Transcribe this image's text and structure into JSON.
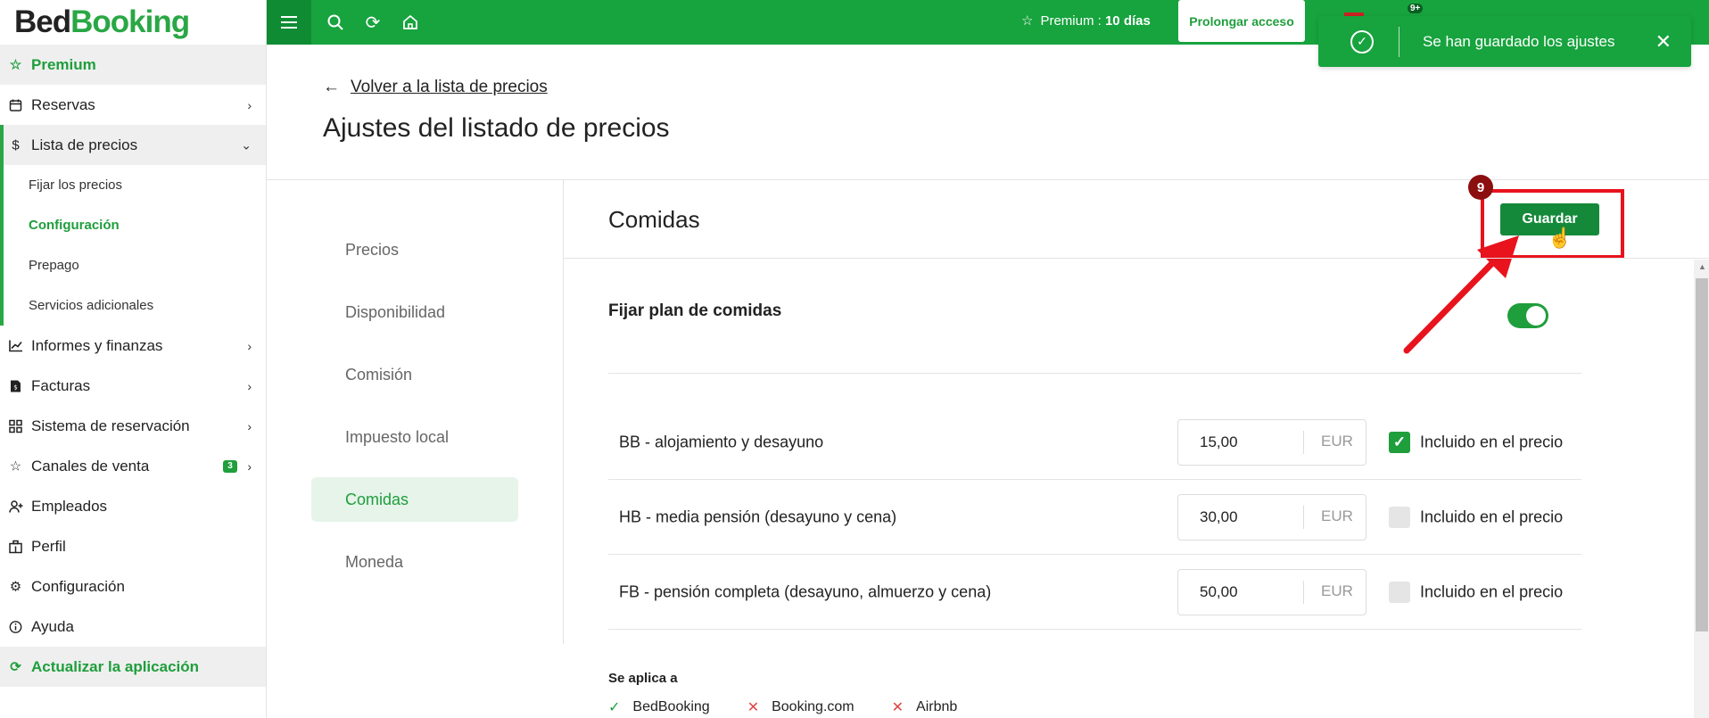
{
  "brand": {
    "part1": "Bed",
    "part2": "Booking"
  },
  "sidebar": {
    "items": [
      {
        "label": "Premium",
        "icon": "star-icon"
      },
      {
        "label": "Reservas",
        "icon": "calendar-icon"
      },
      {
        "label": "Lista de precios",
        "icon": "dollar-icon"
      },
      {
        "label": "Informes y finanzas",
        "icon": "chart-icon"
      },
      {
        "label": "Facturas",
        "icon": "invoice-icon"
      },
      {
        "label": "Sistema de reservación",
        "icon": "grid-icon"
      },
      {
        "label": "Canales de venta",
        "icon": "star-icon",
        "badge": "3"
      },
      {
        "label": "Empleados",
        "icon": "user-plus-icon"
      },
      {
        "label": "Perfil",
        "icon": "building-icon"
      },
      {
        "label": "Configuración",
        "icon": "gear-icon"
      },
      {
        "label": "Ayuda",
        "icon": "info-icon"
      },
      {
        "label": "Actualizar la aplicación",
        "icon": "refresh-icon"
      }
    ],
    "sub_items": [
      {
        "label": "Fijar los precios"
      },
      {
        "label": "Configuración"
      },
      {
        "label": "Prepago"
      },
      {
        "label": "Servicios adicionales"
      }
    ]
  },
  "topbar": {
    "premium_label": "Premium : ",
    "premium_days": "10 días",
    "prolong_label": "Prolongar acceso",
    "notif_badge": "9+"
  },
  "toast": {
    "message": "Se han guardado los ajustes"
  },
  "header": {
    "back_label": "Volver a la lista de precios",
    "title": "Ajustes del listado de precios"
  },
  "settings_menu": [
    {
      "label": "Precios"
    },
    {
      "label": "Disponibilidad"
    },
    {
      "label": "Comisión"
    },
    {
      "label": "Impuesto local"
    },
    {
      "label": "Comidas"
    },
    {
      "label": "Moneda"
    }
  ],
  "section": {
    "title": "Comidas",
    "save_label": "Guardar",
    "step_number": "9",
    "fix_plan_label": "Fijar plan de comidas",
    "fix_plan_enabled": true
  },
  "meals": [
    {
      "label": "BB - alojamiento y desayuno",
      "price": "15,00",
      "currency": "EUR",
      "included": true,
      "included_label": "Incluido en el precio"
    },
    {
      "label": "HB - media pensión (desayuno y cena)",
      "price": "30,00",
      "currency": "EUR",
      "included": false,
      "included_label": "Incluido en el precio"
    },
    {
      "label": "FB - pensión completa (desayuno, almuerzo y cena)",
      "price": "50,00",
      "currency": "EUR",
      "included": false,
      "included_label": "Incluido en el precio"
    }
  ],
  "applies": {
    "label": "Se aplica a",
    "channels": [
      {
        "name": "BedBooking",
        "enabled": true
      },
      {
        "name": "Booking.com",
        "enabled": false
      },
      {
        "name": "Airbnb",
        "enabled": false
      }
    ]
  },
  "colors": {
    "brand_green": "#17a33e",
    "accent_red": "#e8131d"
  }
}
